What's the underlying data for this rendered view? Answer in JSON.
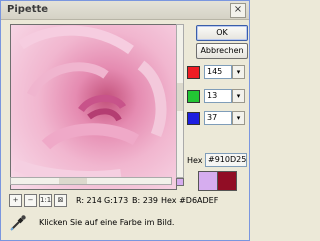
{
  "window": {
    "title": "Pipette",
    "close_label": "×"
  },
  "buttons": {
    "ok": "OK",
    "cancel": "Abbrechen"
  },
  "channels": [
    {
      "name": "red",
      "color": "#ee1c24",
      "value": "145"
    },
    {
      "name": "green",
      "color": "#22c534",
      "value": "13"
    },
    {
      "name": "blue",
      "color": "#1d1ee0",
      "value": "37"
    }
  ],
  "hex": {
    "label": "Hex",
    "value": "#910D25"
  },
  "swatches": {
    "current": "#d6adef",
    "picked": "#910d25"
  },
  "readout": {
    "r": "R: 214",
    "g": "G:173",
    "b": "B: 239",
    "hex": "Hex #D6ADEF"
  },
  "tools": [
    {
      "name": "zoom-in-icon",
      "glyph": "+"
    },
    {
      "name": "zoom-out-icon",
      "glyph": "−"
    },
    {
      "name": "actual-size-icon",
      "glyph": "1:1"
    },
    {
      "name": "fit-window-icon",
      "glyph": "⊠"
    }
  ],
  "hint": "Klicken Sie auf eine Farbe im Bild."
}
